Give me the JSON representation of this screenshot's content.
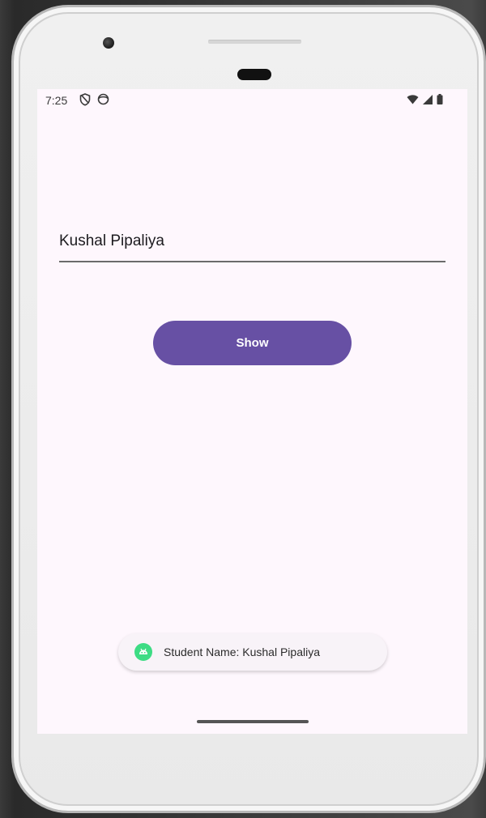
{
  "status_bar": {
    "time": "7:25",
    "left_icons": [
      "shield-icon",
      "face-icon"
    ],
    "right_icons": [
      "wifi-icon",
      "signal-icon",
      "battery-icon"
    ]
  },
  "form": {
    "name_value": "Kushal Pipaliya",
    "show_label": "Show"
  },
  "toast": {
    "icon": "android-icon",
    "message": "Student Name: Kushal Pipaliya"
  },
  "colors": {
    "accent": "#6750a4",
    "screen_background": "#fef7fd",
    "toast_icon": "#3ddc84"
  }
}
